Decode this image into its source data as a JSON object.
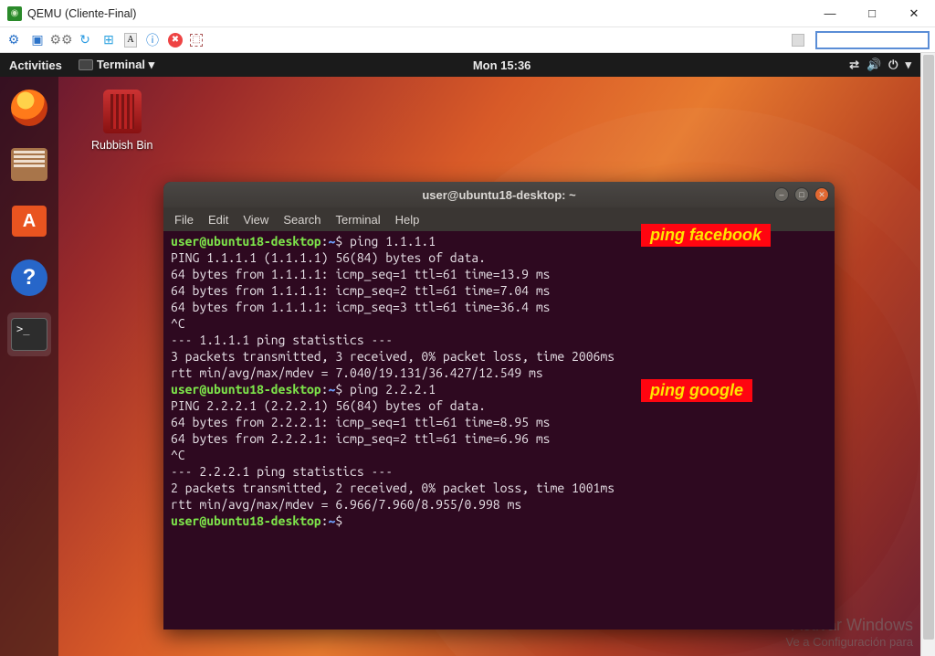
{
  "window": {
    "title": "QEMU (Cliente-Final)",
    "controls": {
      "min": "—",
      "max": "□",
      "close": "✕"
    }
  },
  "qemu_toolbar_icons": [
    "⚙",
    "▣",
    "⚙⚙",
    "↻",
    "⊞",
    "A",
    "ⓘ",
    "✖",
    "⬚"
  ],
  "gnome": {
    "activities": "Activities",
    "terminal_label": "Terminal ▾",
    "clock": "Mon 15:36",
    "status_icons": [
      "⇄",
      "🔊",
      "⏻",
      "▾"
    ]
  },
  "desktop": {
    "rubbish_label": "Rubbish Bin"
  },
  "dock": [
    {
      "name": "firefox",
      "active": false
    },
    {
      "name": "files",
      "active": false
    },
    {
      "name": "software",
      "active": false
    },
    {
      "name": "help",
      "active": false
    },
    {
      "name": "terminal",
      "active": true
    }
  ],
  "terminal": {
    "title": "user@ubuntu18-desktop: ~",
    "menu": [
      "File",
      "Edit",
      "View",
      "Search",
      "Terminal",
      "Help"
    ],
    "prompt_user": "user@ubuntu18-desktop",
    "prompt_path": "~",
    "prompt_sym": "$",
    "cmd1": "ping 1.1.1.1",
    "out1": "PING 1.1.1.1 (1.1.1.1) 56(84) bytes of data.\n64 bytes from 1.1.1.1: icmp_seq=1 ttl=61 time=13.9 ms\n64 bytes from 1.1.1.1: icmp_seq=2 ttl=61 time=7.04 ms\n64 bytes from 1.1.1.1: icmp_seq=3 ttl=61 time=36.4 ms\n^C\n--- 1.1.1.1 ping statistics ---\n3 packets transmitted, 3 received, 0% packet loss, time 2006ms\nrtt min/avg/max/mdev = 7.040/19.131/36.427/12.549 ms",
    "cmd2": "ping 2.2.2.1",
    "out2": "PING 2.2.2.1 (2.2.2.1) 56(84) bytes of data.\n64 bytes from 2.2.2.1: icmp_seq=1 ttl=61 time=8.95 ms\n64 bytes from 2.2.2.1: icmp_seq=2 ttl=61 time=6.96 ms\n^C\n--- 2.2.2.1 ping statistics ---\n2 packets transmitted, 2 received, 0% packet loss, time 1001ms\nrtt min/avg/max/mdev = 6.966/7.960/8.955/0.998 ms"
  },
  "annotations": {
    "a1": "ping facebook",
    "a2": "ping google"
  },
  "watermark": {
    "line1": "Activar Windows",
    "line2": "Ve a Configuración para"
  }
}
